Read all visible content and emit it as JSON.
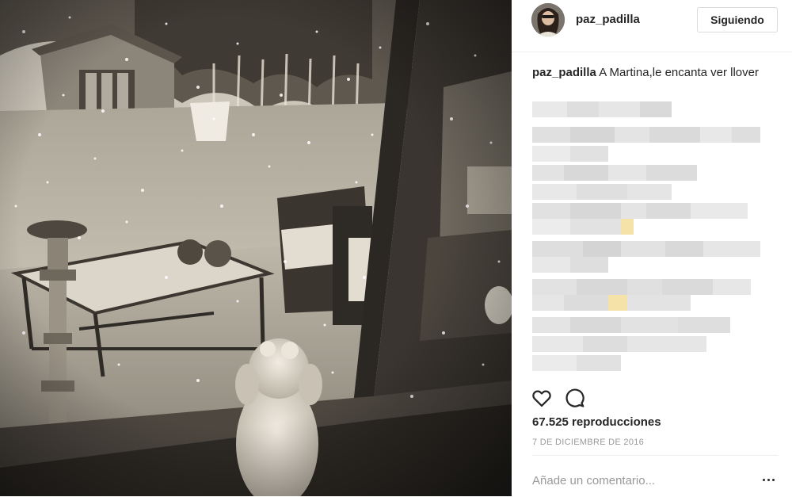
{
  "post": {
    "username": "paz_padilla",
    "follow_label": "Siguiendo",
    "caption": {
      "user": "paz_padilla",
      "text": "A Martina,le encanta ver llover"
    },
    "views": "67.525 reproducciones",
    "date": "7 DE DICIEMBRE DE 2016",
    "comment_placeholder": "Añade un comentario...",
    "icons": {
      "like": "heart-icon",
      "comment": "comment-bubble-icon",
      "more": "ellipsis-icon"
    }
  },
  "colors": {
    "text": "#262626",
    "muted": "#999999",
    "border": "#dbdbdb",
    "divider": "#efefef",
    "blur_gray": "#e2e2e2",
    "blur_yellow": "#f5e2a8"
  }
}
